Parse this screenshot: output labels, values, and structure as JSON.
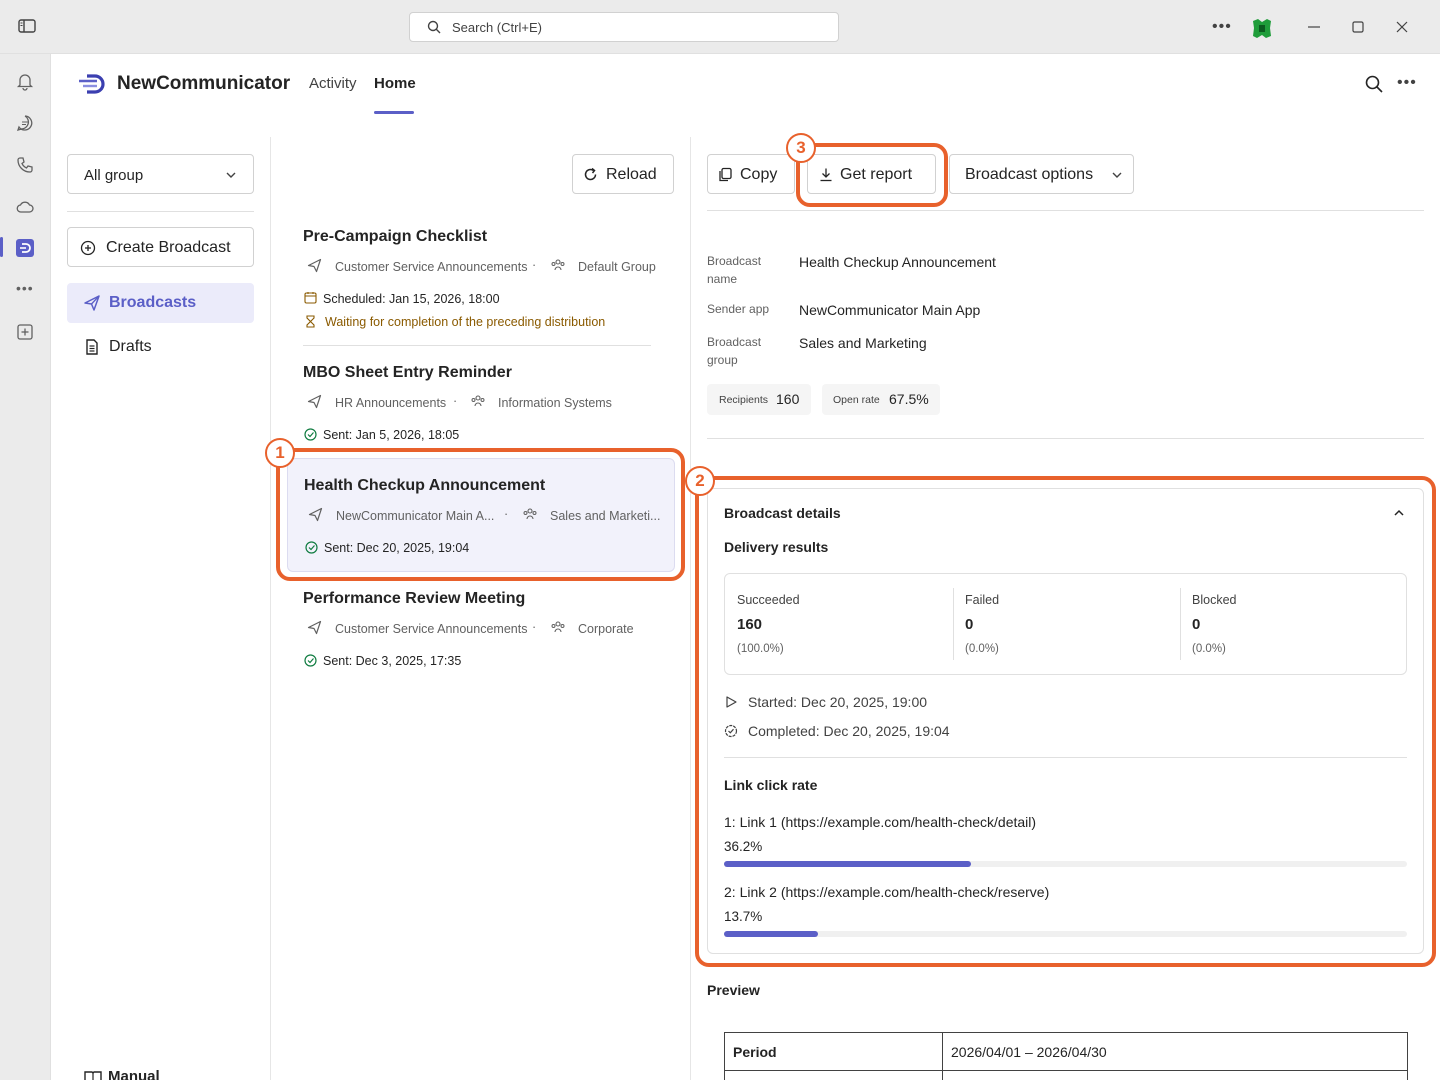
{
  "titlebar": {
    "search_placeholder": "Search (Ctrl+E)",
    "more_label": "•••"
  },
  "app": {
    "name": "NewCommunicator",
    "tabs": [
      {
        "label": "Activity",
        "active": false
      },
      {
        "label": "Home",
        "active": true
      }
    ],
    "more_label": "•••"
  },
  "left_nav": {
    "group_filter": "All group",
    "create_label": "Create Broadcast",
    "items": [
      {
        "label": "Broadcasts",
        "active": true
      },
      {
        "label": "Drafts",
        "active": false
      }
    ],
    "manual_label": "Manual"
  },
  "list": {
    "reload_label": "Reload",
    "broadcasts": [
      {
        "title": "Pre-Campaign Checklist",
        "sender": "Customer Service Announcements",
        "group": "Default Group",
        "status": "Scheduled: Jan 15, 2026, 18:00",
        "note": "Waiting for completion of the preceding distribution"
      },
      {
        "title": "MBO Sheet Entry Reminder",
        "sender": "HR Announcements",
        "group": "Information Systems",
        "status": "Sent: Jan 5, 2026, 18:05"
      },
      {
        "title": "Health Checkup Announcement",
        "sender": "NewCommunicator Main A...",
        "group": "Sales and Marketi...",
        "status": "Sent: Dec 20, 2025, 19:04",
        "selected": true
      },
      {
        "title": "Performance Review Meeting",
        "sender": "Customer Service Announcements",
        "group": "Corporate",
        "status": "Sent: Dec 3, 2025, 17:35"
      }
    ]
  },
  "detail": {
    "actions": {
      "copy_label": "Copy",
      "report_label": "Get report",
      "options_label": "Broadcast options"
    },
    "fields": [
      {
        "key": "Broadcast name",
        "value": "Health Checkup Announcement"
      },
      {
        "key": "Sender app",
        "value": "NewCommunicator Main App"
      },
      {
        "key": "Broadcast group",
        "value": "Sales and Marketing"
      }
    ],
    "recipients_label": "Recipients",
    "recipients_value": "160",
    "open_rate_label": "Open rate",
    "open_rate_value": "67.5%",
    "details_title": "Broadcast details",
    "delivery_title": "Delivery results",
    "stats": [
      {
        "label": "Succeeded",
        "value": "160",
        "pct": "(100.0%)"
      },
      {
        "label": "Failed",
        "value": "0",
        "pct": "(0.0%)"
      },
      {
        "label": "Blocked",
        "value": "0",
        "pct": "(0.0%)"
      }
    ],
    "started": "Started:  Dec 20, 2025, 19:00",
    "completed": "Completed:  Dec 20, 2025, 19:04",
    "link_click_title": "Link click rate",
    "links": [
      {
        "label": "1: Link 1 (https://example.com/health-check/detail)",
        "pct_text": "36.2%",
        "rate": 0.362
      },
      {
        "label": "2: Link 2 (https://example.com/health-check/reserve)",
        "pct_text": "13.7%",
        "rate": 0.137
      }
    ],
    "preview_title": "Preview",
    "preview_rows": [
      {
        "key": "Period",
        "value": "2026/04/01 – 2026/04/30"
      }
    ]
  },
  "annotations": [
    "1",
    "2",
    "3"
  ],
  "colors": {
    "accent": "#5b5fc7",
    "annotation": "#e8612c",
    "success": "#107c41",
    "warning": "#8a5a00"
  }
}
